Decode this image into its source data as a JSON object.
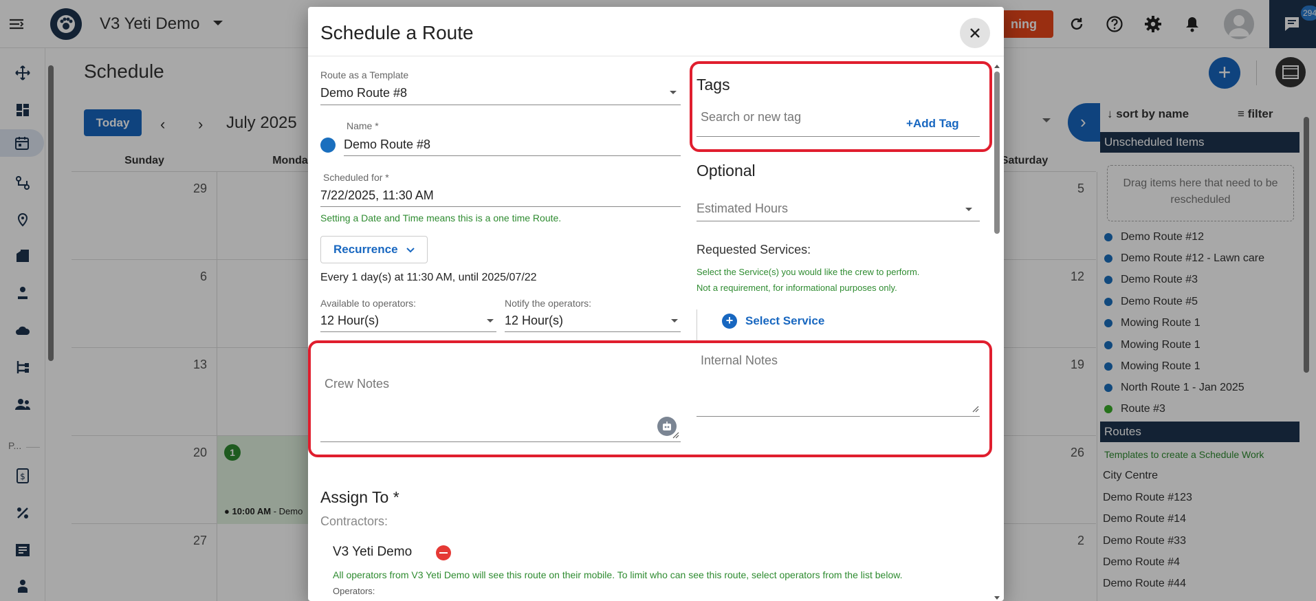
{
  "app": {
    "title": "V3 Yeti Demo",
    "top_cta_label": "ning",
    "chat_badge": "294",
    "colors": {
      "primary": "#1867c0",
      "navy": "#1e3550",
      "danger": "#e53935",
      "success": "#2e8b30",
      "highlight": "#e01e2e"
    }
  },
  "rail": {
    "items": [
      "move-icon",
      "dashboard-icon",
      "calendar-icon",
      "route-icon",
      "map-pin-icon",
      "building-icon",
      "worker-icon",
      "cloud-icon",
      "hierarchy-icon",
      "people-icon",
      "invoice-icon",
      "percent-icon",
      "checklist-icon",
      "operator-icon"
    ],
    "section_label": "P..."
  },
  "schedule": {
    "title": "Schedule",
    "today_label": "Today",
    "month_label": "July 2025",
    "weekdays": [
      "Sunday",
      "Monda",
      "",
      "",
      "",
      "",
      "Saturday"
    ],
    "weeks": [
      {
        "sunday": "29",
        "saturday": "5"
      },
      {
        "sunday": "6",
        "saturday": "12"
      },
      {
        "sunday": "13",
        "saturday": "19"
      },
      {
        "sunday": "20",
        "saturday": "26",
        "monday_badge": "1",
        "monday_event_time": "10:00 AM",
        "monday_event_rest": " - Demo"
      },
      {
        "sunday": "27",
        "saturday": "2"
      }
    ]
  },
  "right_panel": {
    "sort_label": "sort by name",
    "filter_label": "filter",
    "unscheduled_header": "Unscheduled Items",
    "drop_hint": "Drag items here that need to be rescheduled",
    "unscheduled_items": [
      {
        "label": "Demo Route #12",
        "color": "blue"
      },
      {
        "label": "Demo Route #12 - Lawn care",
        "color": "blue"
      },
      {
        "label": "Demo Route #3",
        "color": "blue"
      },
      {
        "label": "Demo Route #5",
        "color": "blue"
      },
      {
        "label": "Mowing Route 1",
        "color": "blue"
      },
      {
        "label": "Mowing Route 1",
        "color": "blue"
      },
      {
        "label": "Mowing Route 1",
        "color": "blue"
      },
      {
        "label": "North Route 1 - Jan 2025",
        "color": "blue"
      },
      {
        "label": "Route #3",
        "color": "green"
      }
    ],
    "routes_header": "Routes",
    "routes_hint": "Templates to create a Schedule Work",
    "routes": [
      "City Centre",
      "Demo Route #123",
      "Demo Route #14",
      "Demo Route #33",
      "Demo Route #4",
      "Demo Route #44"
    ]
  },
  "modal": {
    "title": "Schedule a Route",
    "template": {
      "label": "Route as a Template",
      "value": "Demo Route #8"
    },
    "name": {
      "label": "Name  *",
      "value": "Demo Route #8"
    },
    "scheduled": {
      "label": "Scheduled for  *",
      "value": "7/22/2025, 11:30 AM",
      "hint": "Setting a Date and Time means this is a one time Route."
    },
    "recurrence_label": "Recurrence",
    "recurrence_summary": "Every 1 day(s) at 11:30 AM, until 2025/07/22",
    "available": {
      "label": "Available to operators:",
      "value": "12 Hour(s)"
    },
    "notify": {
      "label": "Notify the operators:",
      "value": "12 Hour(s)"
    },
    "tags": {
      "title": "Tags",
      "placeholder": "Search or new tag",
      "add_label": "Add Tag"
    },
    "optional": {
      "title": "Optional",
      "estimated_hours_placeholder": "Estimated Hours"
    },
    "services": {
      "title": "Requested Services:",
      "hint_1": "Select the Service(s) you would like the crew to perform.",
      "hint_2": "Not a requirement, for informational purposes only.",
      "select_label": "Select Service"
    },
    "notes": {
      "crew_placeholder": "Crew Notes",
      "internal_placeholder": "Internal Notes"
    },
    "assign": {
      "title": "Assign To *",
      "contractors_label": "Contractors:",
      "contractor_name": "V3 Yeti Demo",
      "operators_hint": "All operators from V3 Yeti Demo will see this route on their mobile. To limit who can see this route, select operators from the list below.",
      "operators_label": "Operators:"
    }
  }
}
